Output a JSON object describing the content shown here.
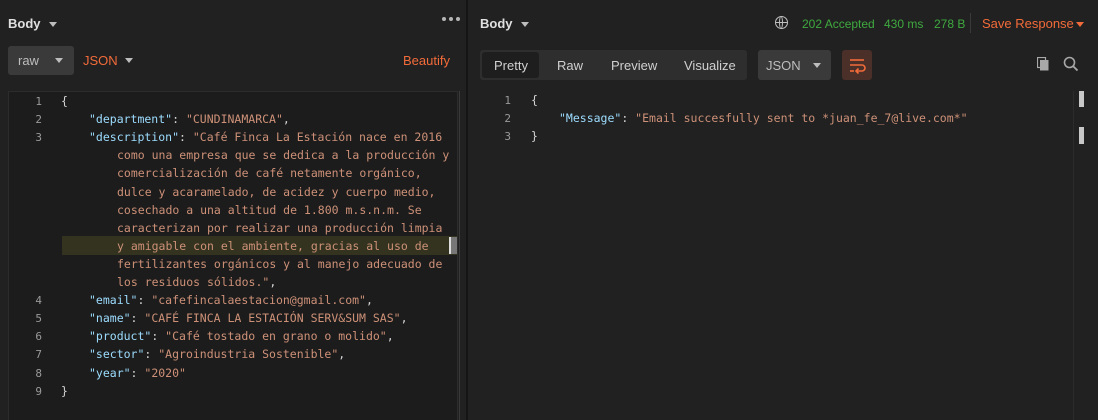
{
  "request_panel": {
    "title": "Body",
    "body_type": "raw",
    "language": "JSON",
    "beautify_label": "Beautify",
    "code_lines": [
      {
        "n": "1",
        "key": "",
        "value": "",
        "open": "{",
        "close": ""
      },
      {
        "n": "2",
        "key": "\"department\"",
        "value": "\"CUNDINAMARCA\"",
        "open": "",
        "close": ","
      },
      {
        "n": "3",
        "key": "\"description\"",
        "value": "\"Café Finca La Estación nace en 2016",
        "open": "",
        "close": ""
      },
      {
        "n": "",
        "key": "",
        "value": "como una empresa que se dedica a la producción y",
        "open": "",
        "close": ""
      },
      {
        "n": "",
        "key": "",
        "value": "comercialización de café netamente orgánico,",
        "open": "",
        "close": ""
      },
      {
        "n": "",
        "key": "",
        "value": "dulce y acaramelado, de acidez y cuerpo medio,",
        "open": "",
        "close": ""
      },
      {
        "n": "",
        "key": "",
        "value": "cosechado a una altitud de 1.800 m.s.n.m. Se",
        "open": "",
        "close": ""
      },
      {
        "n": "",
        "key": "",
        "value": "caracterizan por realizar una producción limpia",
        "open": "",
        "close": ""
      },
      {
        "n": "",
        "key": "",
        "value": "y amigable con el ambiente, gracias al uso de",
        "open": "",
        "close": ""
      },
      {
        "n": "",
        "key": "",
        "value": "fertilizantes orgánicos y al manejo adecuado de",
        "open": "",
        "close": ""
      },
      {
        "n": "",
        "key": "",
        "value": "los residuos sólidos.\"",
        "open": "",
        "close": ","
      },
      {
        "n": "4",
        "key": "\"email\"",
        "value": "\"cafefincalaestacion@gmail.com\"",
        "open": "",
        "close": ","
      },
      {
        "n": "5",
        "key": "\"name\"",
        "value": "\"CAFÉ FINCA LA ESTACIÓN SERV&SUM SAS\"",
        "open": "",
        "close": ","
      },
      {
        "n": "6",
        "key": "\"product\"",
        "value": "\"Café tostado en grano o molido\"",
        "open": "",
        "close": ","
      },
      {
        "n": "7",
        "key": "\"sector\"",
        "value": "\"Agroindustria Sostenible\"",
        "open": "",
        "close": ","
      },
      {
        "n": "8",
        "key": "\"year\"",
        "value": "\"2020\"",
        "open": "",
        "close": ""
      },
      {
        "n": "9",
        "key": "",
        "value": "",
        "open": "}",
        "close": ""
      }
    ]
  },
  "response_panel": {
    "title": "Body",
    "status": "202 Accepted",
    "time": "430 ms",
    "size": "278 B",
    "save_label": "Save Response",
    "tabs": [
      "Pretty",
      "Raw",
      "Preview",
      "Visualize"
    ],
    "active_tab": "Pretty",
    "format": "JSON",
    "code_lines": [
      {
        "n": "1",
        "key": "",
        "value": "",
        "open": "{",
        "close": ""
      },
      {
        "n": "2",
        "key": "\"Message\"",
        "value": "\"Email succesfully sent to *juan_fe_7@live.com*\"",
        "open": "",
        "close": ""
      },
      {
        "n": "3",
        "key": "",
        "value": "",
        "open": "}",
        "close": ""
      }
    ]
  },
  "colors": {
    "accent": "#f26b3a",
    "status_ok": "#3fa93f",
    "json_key": "#9cdcfe",
    "json_string": "#ce9178"
  },
  "icons": [
    "caret-down-icon",
    "more-dots-icon",
    "globe-icon",
    "wrap-lines-icon",
    "copy-icon",
    "search-icon"
  ]
}
